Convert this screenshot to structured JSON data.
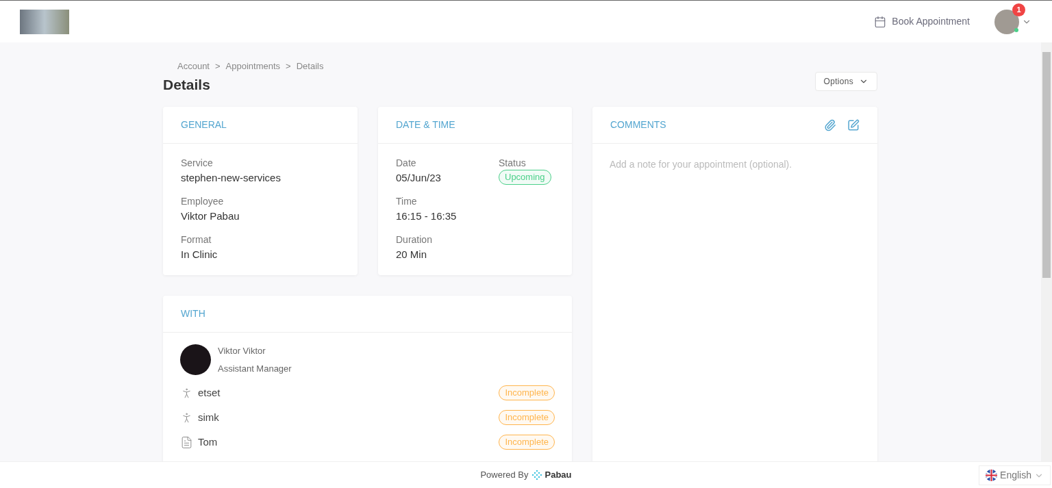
{
  "header": {
    "book_label": "Book Appointment",
    "notification_count": "1",
    "online": true
  },
  "breadcrumb": {
    "separator": ">",
    "items": [
      "Account",
      "Appointments",
      "Details"
    ]
  },
  "page_title": "Details",
  "options_label": "Options",
  "general": {
    "title": "GENERAL",
    "fields": [
      {
        "label": "Service",
        "value": "stephen-new-services"
      },
      {
        "label": "Employee",
        "value": "Viktor Pabau"
      },
      {
        "label": "Format",
        "value": "In Clinic"
      }
    ]
  },
  "date_time": {
    "title": "DATE & TIME",
    "date_label": "Date",
    "date": "05/Jun/23",
    "status_label": "Status",
    "status": {
      "text": "Upcoming",
      "color": "#4cd08a"
    },
    "time_label": "Time",
    "time": "16:15 - 16:35",
    "duration_label": "Duration",
    "duration": "20 Min"
  },
  "with": {
    "title": "WITH",
    "person": {
      "name": "Viktor Viktor",
      "role": "Assistant Manager"
    },
    "forms": [
      {
        "kind": "treatment",
        "name": "etset",
        "status": "Incomplete",
        "color": "#ffb54d"
      },
      {
        "kind": "treatment",
        "name": "simk",
        "status": "Incomplete",
        "color": "#ffb54d"
      },
      {
        "kind": "document",
        "name": "Tom",
        "status": "Incomplete",
        "color": "#ffb54d"
      }
    ]
  },
  "comments": {
    "title": "COMMENTS",
    "placeholder": "Add a note for your appointment (optional)."
  },
  "footer": {
    "powered_by": "Powered By",
    "brand": "Pabau",
    "language": "English"
  }
}
